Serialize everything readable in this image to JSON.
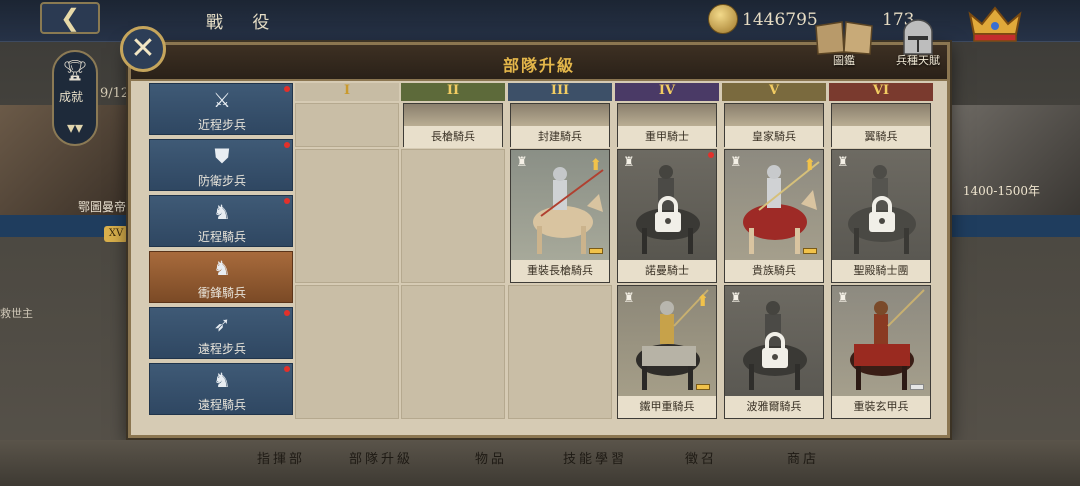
{
  "topbar": {
    "title": "戰 役",
    "coins": "1446795",
    "resource2": "173"
  },
  "background": {
    "progress": "9/12",
    "left_caption": "鄂圖曼帝",
    "right_caption": "1400-1500年",
    "left_sub": "救世主",
    "level_badge": "XV"
  },
  "achievements": {
    "label": "成就"
  },
  "modal": {
    "title": "部隊升級",
    "codex_label": "圖鑑",
    "talent_label": "兵種天賦"
  },
  "categories": [
    {
      "label": "近程步兵",
      "icon": "crossed-swords-icon"
    },
    {
      "label": "防衛步兵",
      "icon": "shield-icon"
    },
    {
      "label": "近程騎兵",
      "icon": "horse-head-icon"
    },
    {
      "label": "衝鋒騎兵",
      "icon": "lancer-icon"
    },
    {
      "label": "遠程步兵",
      "icon": "bow-icon"
    },
    {
      "label": "遠程騎兵",
      "icon": "horse-archer-icon"
    }
  ],
  "tiers": [
    "I",
    "II",
    "III",
    "IV",
    "V",
    "VI"
  ],
  "row1": [
    "長槍騎兵",
    "封建騎兵",
    "重甲騎士",
    "皇家騎兵",
    "翼騎兵"
  ],
  "row2": [
    "重裝長槍騎兵",
    "諾曼騎士",
    "貴族騎兵",
    "聖殿騎士團"
  ],
  "row3": [
    "鐵甲重騎兵",
    "波雅爾騎兵",
    "重裝玄甲兵"
  ],
  "bottom_nav": [
    "指揮部",
    "部隊升級",
    "物品",
    "技能學習",
    "徵召",
    "商店"
  ],
  "colors": {
    "accent_gold": "#e3b64a",
    "category_blue": "#3f5a76",
    "category_active": "#a86b3c",
    "notification_red": "#e3302a"
  }
}
